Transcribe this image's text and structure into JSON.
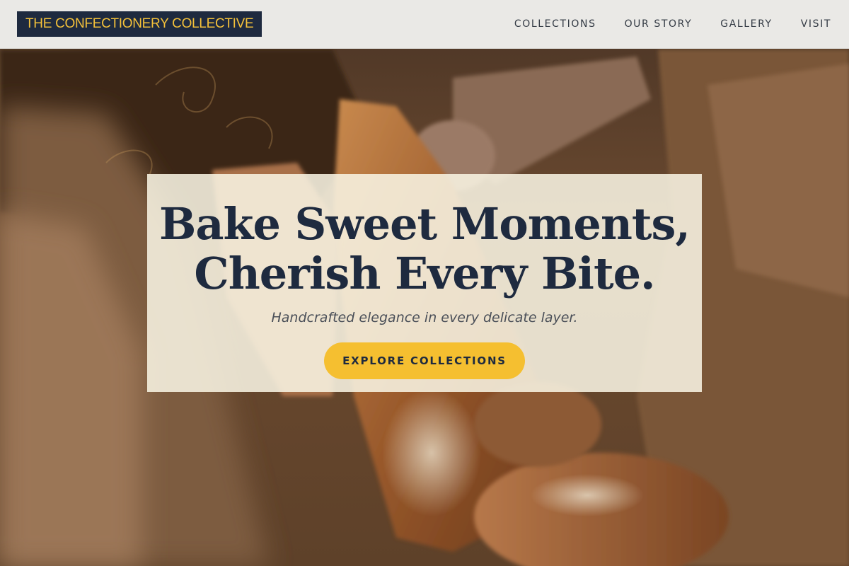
{
  "header": {
    "brand": "THE CONFECTIONERY COLLECTIVE",
    "nav": [
      {
        "label": "COLLECTIONS"
      },
      {
        "label": "OUR STORY"
      },
      {
        "label": "GALLERY"
      },
      {
        "label": "VISIT"
      }
    ]
  },
  "hero": {
    "title_line_1": "Bake Sweet Moments,",
    "title_line_2": "Cherish Every Bite.",
    "subtitle": "Handcrafted elegance in every delicate layer.",
    "cta_label": "EXPLORE COLLECTIONS",
    "background_image": "bread-loaves-in-paper-bag"
  },
  "colors": {
    "brand_navy": "#1e2a3f",
    "accent_yellow": "#f5bf30",
    "brand_text_yellow": "#f4c13a",
    "card_cream": "#f8f4e2"
  }
}
